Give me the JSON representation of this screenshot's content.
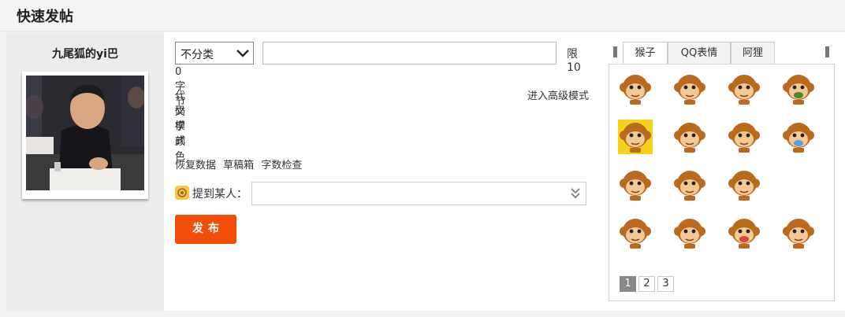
{
  "header": {
    "title": "快速发帖"
  },
  "user": {
    "name": "九尾狐的yi巴"
  },
  "form": {
    "category_selected": "不分类",
    "title_value": "",
    "limit_label": "限10",
    "byte_count": "0 字节",
    "code_mode": "代码模式",
    "text_color": "文字颜色",
    "advanced_mode": "进入高级模式",
    "tools": [
      "恢复数据",
      "草稿箱",
      "字数检查"
    ],
    "mention_label": "提到某人：",
    "mention_value": "",
    "publish_label": "发布"
  },
  "emoji": {
    "tabs": [
      "猴子",
      "QQ表情",
      "阿狸"
    ],
    "active_tab": 0,
    "pages": [
      "1",
      "2",
      "3"
    ],
    "active_page": 0,
    "items": [
      {
        "name": "monkey-sleepy-icon"
      },
      {
        "name": "monkey-shy-icon"
      },
      {
        "name": "monkey-sweat-icon"
      },
      {
        "name": "monkey-angry-fire-icon"
      },
      {
        "name": "monkey-money-icon"
      },
      {
        "name": "monkey-drool-icon"
      },
      {
        "name": "monkey-victory-icon"
      },
      {
        "name": "monkey-cry-icon"
      },
      {
        "name": "monkey-grumpy-icon"
      },
      {
        "name": "monkey-think-icon"
      },
      {
        "name": "monkey-smile-icon"
      },
      {
        "name": "monkey-bandage-icon"
      },
      {
        "name": "monkey-surprised-icon"
      },
      {
        "name": "monkey-blush-icon"
      },
      {
        "name": "monkey-glasses-icon"
      }
    ]
  },
  "colors": {
    "accent": "#f14e0a",
    "monkey_fur": "#b86a1e",
    "monkey_face": "#f2c896"
  }
}
